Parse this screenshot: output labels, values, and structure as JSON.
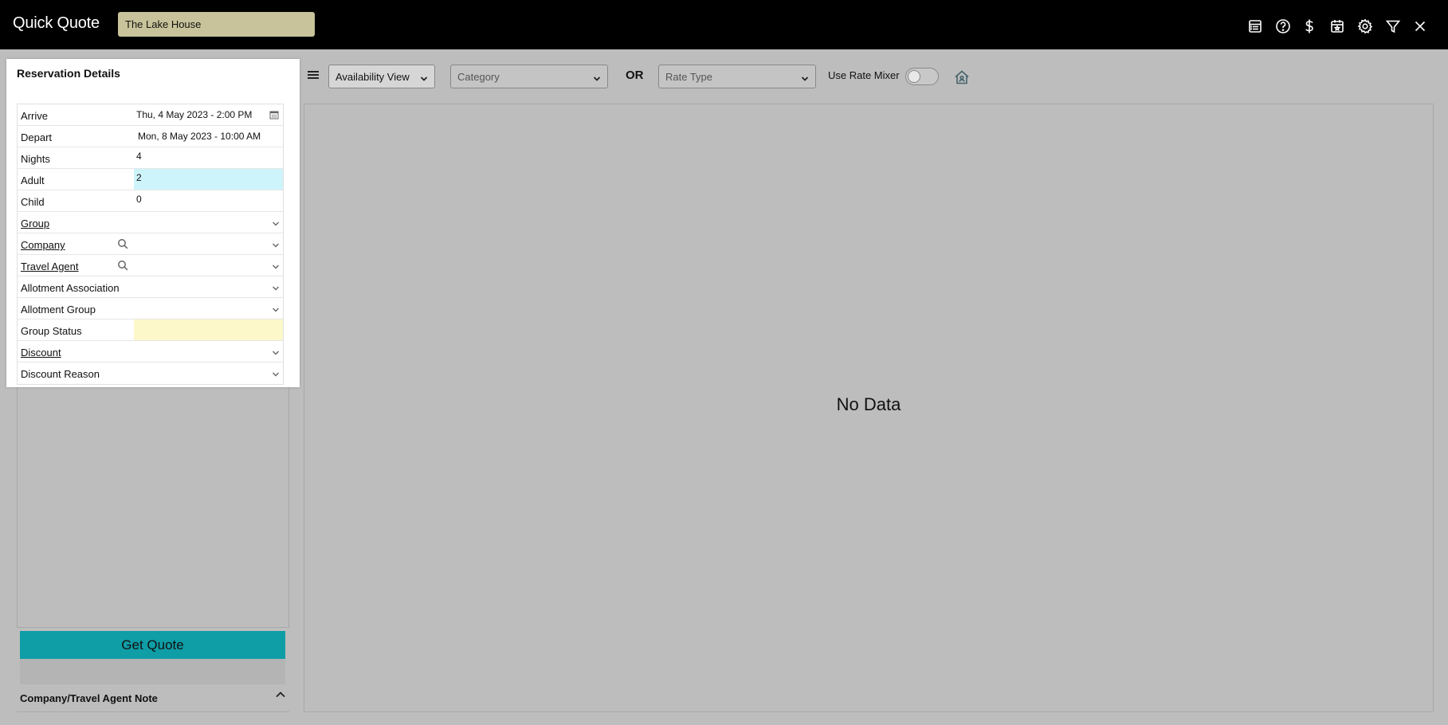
{
  "header": {
    "title": "Quick Quote",
    "property": "The Lake House",
    "icons": [
      "report-icon",
      "help-icon",
      "dollar-icon",
      "calendar-star-icon",
      "gear-icon",
      "filter-icon",
      "close-icon"
    ]
  },
  "reservation": {
    "title": "Reservation Details",
    "fields": {
      "arrive": {
        "label": "Arrive",
        "value": "Thu, 4 May 2023 - 2:00 PM"
      },
      "depart": {
        "label": "Depart",
        "value": "Mon, 8 May 2023 - 10:00 AM"
      },
      "nights": {
        "label": "Nights",
        "value": "4"
      },
      "adult": {
        "label": "Adult",
        "value": "2"
      },
      "child": {
        "label": "Child",
        "value": "0"
      },
      "group": {
        "label": "Group",
        "value": ""
      },
      "company": {
        "label": "Company",
        "value": ""
      },
      "travel_agent": {
        "label": "Travel Agent",
        "value": ""
      },
      "allotment_association": {
        "label": "Allotment Association",
        "value": ""
      },
      "allotment_group": {
        "label": "Allotment Group",
        "value": ""
      },
      "group_status": {
        "label": "Group Status",
        "value": ""
      },
      "discount": {
        "label": "Discount",
        "value": ""
      },
      "discount_reason": {
        "label": "Discount Reason",
        "value": ""
      }
    }
  },
  "actions": {
    "get_quote": "Get Quote",
    "note_header": "Company/Travel Agent Note"
  },
  "toolbar": {
    "view": "Availability View",
    "category_placeholder": "Category",
    "or_label": "OR",
    "rate_type_placeholder": "Rate Type",
    "rate_mixer_label": "Use Rate Mixer",
    "rate_mixer_on": false
  },
  "main": {
    "empty_text": "No Data"
  },
  "colors": {
    "topbar": "#000000",
    "property_box": "#c8c39a",
    "accent_button": "#0f9da6",
    "active_field": "#cdf4fb",
    "status_field": "#fdf8c9",
    "background": "#bdbdbd"
  }
}
